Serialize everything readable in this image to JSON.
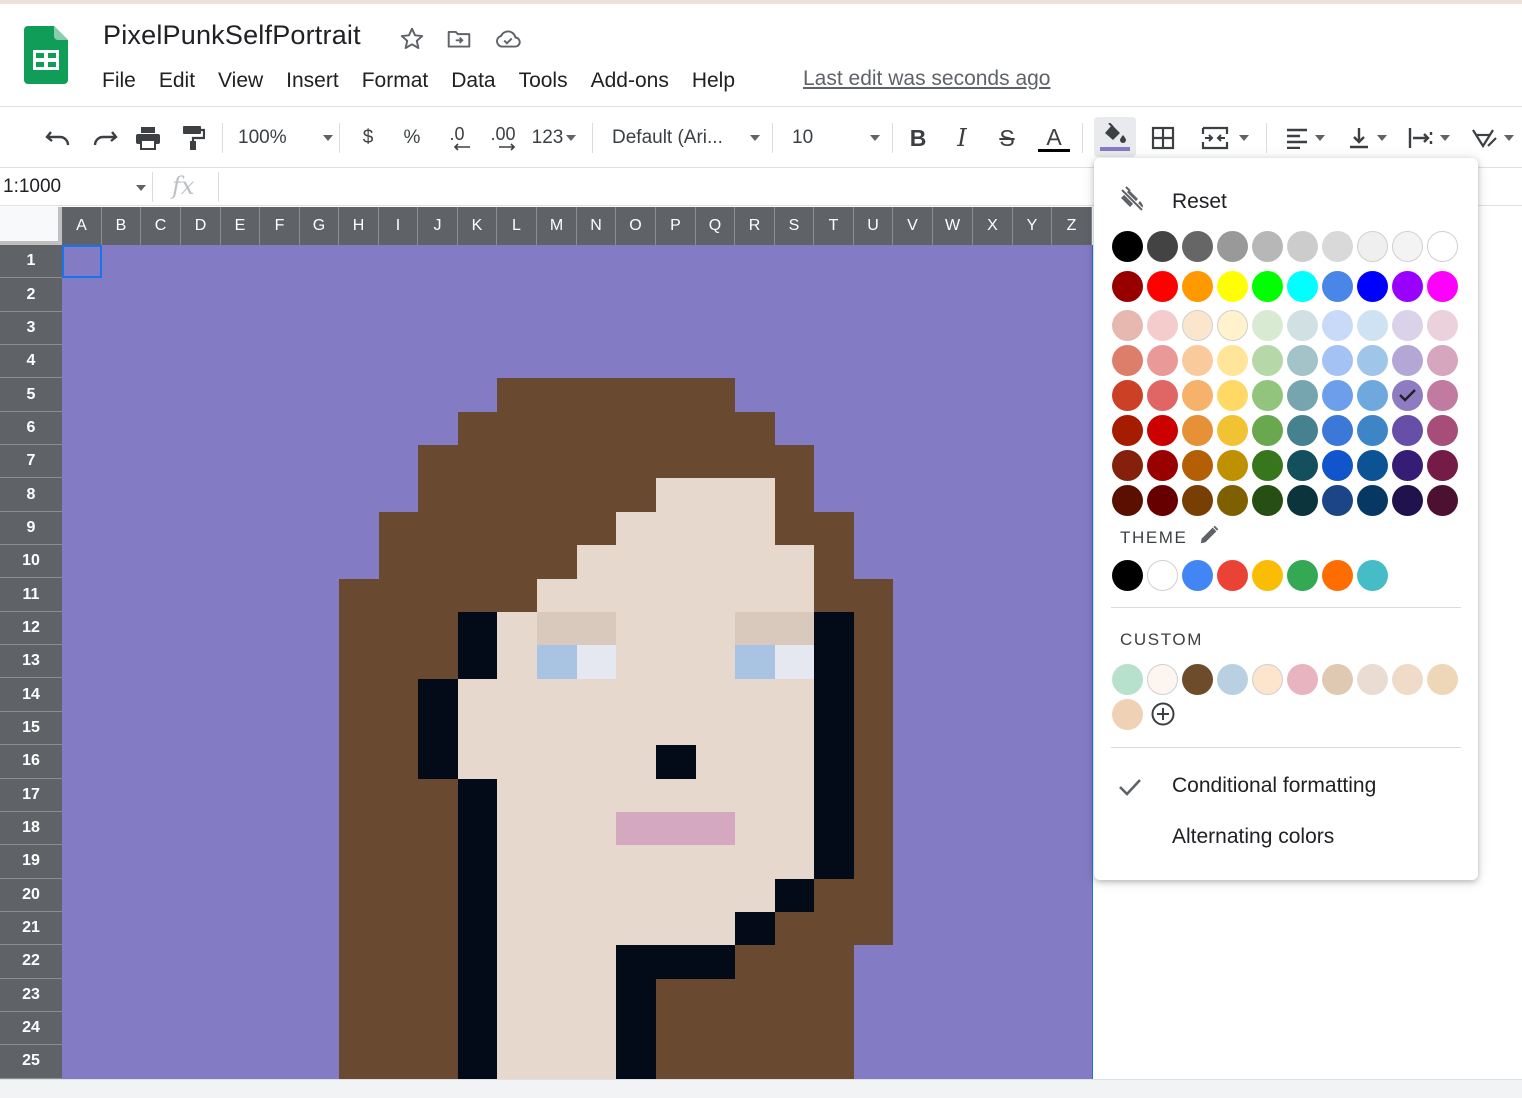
{
  "doc": {
    "title": "PixelPunkSelfPortrait",
    "last_edit": "Last edit was seconds ago"
  },
  "menu": [
    "File",
    "Edit",
    "View",
    "Insert",
    "Format",
    "Data",
    "Tools",
    "Add-ons",
    "Help"
  ],
  "toolbar": {
    "zoom": "100%",
    "currency": "$",
    "percent": "%",
    "decimal_decrease": ".0",
    "decimal_increase": ".00",
    "more_formats": "123",
    "font": "Default (Ari...",
    "font_size": "10",
    "bold": "B",
    "italic": "I",
    "strikethrough": "S",
    "text_color": "A",
    "fill_color_current": "#837bc4"
  },
  "formula_bar": {
    "name_box": "1:1000",
    "fx": "fx"
  },
  "grid": {
    "columns": [
      "A",
      "B",
      "C",
      "D",
      "E",
      "F",
      "G",
      "H",
      "I",
      "J",
      "K",
      "L",
      "M",
      "N",
      "O",
      "P",
      "Q",
      "R",
      "S",
      "T",
      "U",
      "V",
      "W",
      "X",
      "Y",
      "Z"
    ],
    "rows": [
      "1",
      "2",
      "3",
      "4",
      "5",
      "6",
      "7",
      "8",
      "9",
      "10",
      "11",
      "12",
      "13",
      "14",
      "15",
      "16",
      "17",
      "18",
      "19",
      "20",
      "21",
      "22",
      "23",
      "24",
      "25"
    ],
    "colors": {
      "background": "#837bc4",
      "hair": "#6a4931",
      "skin": "#e6d8cd",
      "outline": "#040b18",
      "brow": "#d9c9bd",
      "eye_blue": "#a9c4e2",
      "eye_white": "#e6e8f1",
      "mouth": "#d4a9c0"
    }
  },
  "palette": {
    "reset_label": "Reset",
    "grays": [
      "#000000",
      "#434343",
      "#666666",
      "#999999",
      "#b7b7b7",
      "#cccccc",
      "#d9d9d9",
      "#efefef",
      "#f3f3f3",
      "#ffffff"
    ],
    "rows": [
      [
        "#980000",
        "#ff0000",
        "#ff9900",
        "#ffff00",
        "#00ff00",
        "#00ffff",
        "#4a86e8",
        "#0000ff",
        "#9900ff",
        "#ff00ff"
      ],
      [
        "#e6b8af",
        "#f4cccc",
        "#fce5cd",
        "#fff2cc",
        "#d9ead3",
        "#d0e0e3",
        "#c9daf8",
        "#cfe2f3",
        "#d9d2e9",
        "#ead1dc"
      ],
      [
        "#dd7e6b",
        "#ea9999",
        "#f9cb9c",
        "#ffe599",
        "#b6d7a8",
        "#a2c4c9",
        "#a4c2f4",
        "#9fc5e8",
        "#b4a7d6",
        "#d5a6bd"
      ],
      [
        "#cc4125",
        "#e06666",
        "#f6b26b",
        "#ffd966",
        "#93c47d",
        "#76a5af",
        "#6d9eeb",
        "#6fa8dc",
        "#8e7cc3",
        "#c27ba0"
      ],
      [
        "#a61c00",
        "#cc0000",
        "#e69138",
        "#f1c232",
        "#6aa84f",
        "#45818e",
        "#3c78d8",
        "#3d85c6",
        "#674ea7",
        "#a64d79"
      ],
      [
        "#85200c",
        "#990000",
        "#b45f06",
        "#bf9000",
        "#38761d",
        "#134f5c",
        "#1155cc",
        "#0b5394",
        "#351c75",
        "#741b47"
      ],
      [
        "#5b0f00",
        "#660000",
        "#783f04",
        "#7f6000",
        "#274e13",
        "#0c343d",
        "#1c4587",
        "#073763",
        "#20124d",
        "#4c1130"
      ]
    ],
    "selected": "#8e7cc3",
    "theme_label": "THEME",
    "theme": [
      "#000000",
      "#ffffff",
      "#4285f4",
      "#ea4335",
      "#fbbc04",
      "#34a853",
      "#ff6d01",
      "#46bdc6"
    ],
    "custom_label": "CUSTOM",
    "custom": [
      "#b7e1cd",
      "#fdf6f0",
      "#6d4c2b",
      "#b8d0e2",
      "#fde4cc",
      "#e8b4bf",
      "#e0c9b2",
      "#eadbd3",
      "#efdbc8",
      "#eed6b8",
      "#efd2b6"
    ],
    "conditional_formatting": "Conditional formatting",
    "alternating_colors": "Alternating colors"
  }
}
